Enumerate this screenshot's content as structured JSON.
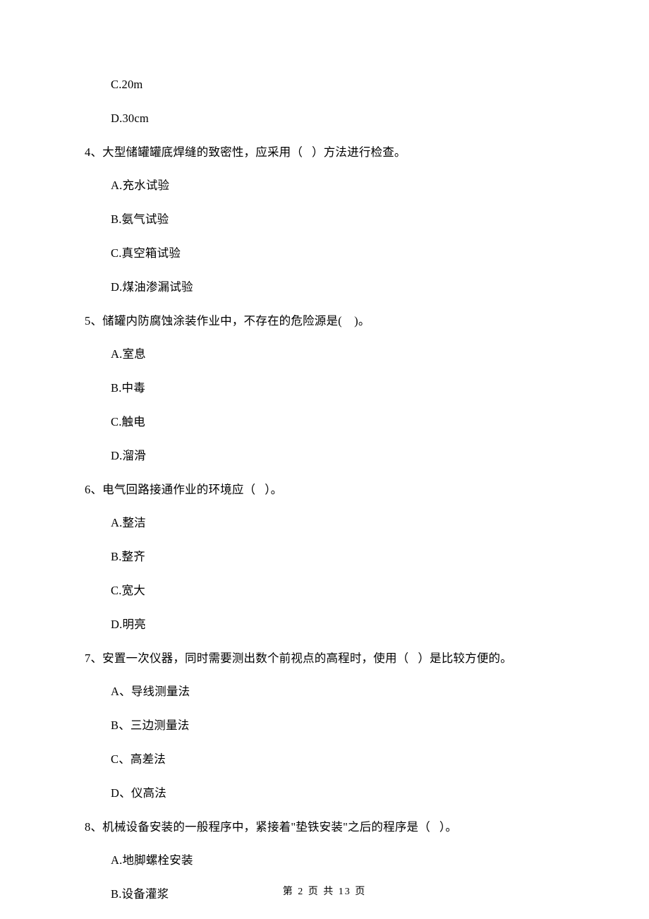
{
  "lines": {
    "opt_3c": "C.20m",
    "opt_3d": "D.30cm",
    "q4": "4、大型储罐罐底焊缝的致密性，应采用（   ）方法进行检查。",
    "opt_4a": "A.充水试验",
    "opt_4b": "B.氨气试验",
    "opt_4c": "C.真空箱试验",
    "opt_4d": "D.煤油渗漏试验",
    "q5": "5、储罐内防腐蚀涂装作业中，不存在的危险源是(    )。",
    "opt_5a": "A.室息",
    "opt_5b": "B.中毒",
    "opt_5c": "C.触电",
    "opt_5d": "D.溜滑",
    "q6": "6、电气回路接通作业的环境应（   ）。",
    "opt_6a": "A.整洁",
    "opt_6b": "B.整齐",
    "opt_6c": "C.宽大",
    "opt_6d": "D.明亮",
    "q7": "7、安置一次仪器，同时需要测出数个前视点的高程时，使用（   ）是比较方便的。",
    "opt_7a": "A、导线测量法",
    "opt_7b": "B、三边测量法",
    "opt_7c": "C、高差法",
    "opt_7d": "D、仪高法",
    "q8": "8、机械设备安装的一般程序中，紧接着\"垫铁安装\"之后的程序是（   ）。",
    "opt_8a": "A.地脚螺栓安装",
    "opt_8b": "B.设备灌浆"
  },
  "footer": "第 2 页 共 13 页"
}
